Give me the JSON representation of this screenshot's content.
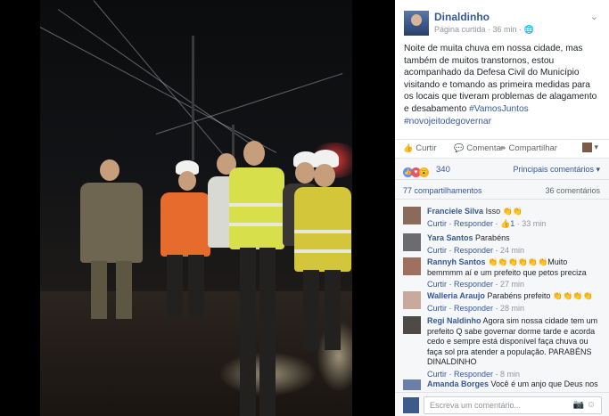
{
  "post": {
    "author": "Dinaldinho",
    "meta": "Página curtida · 36 min · 🌐",
    "text": "Noite de muita chuva em nossa cidade, mas também de muitos transtornos, estou acompanhado da Defesa Civil do Município visitando e tomando as primeira medidas para os locais que tiveram problemas de alagamento e desabamento",
    "hashtags": "#VamosJuntos #novojeitodegovernar",
    "caret": "⌄"
  },
  "actions": {
    "like": "Curtir",
    "comment": "Comentar",
    "share": "Compartilhar",
    "viewer_caret": "▾"
  },
  "reactions": {
    "count": "340",
    "top_comments": "Principais comentários ▾",
    "shares": "77 compartilhamentos",
    "comments": "36 comentários"
  },
  "comments": [
    {
      "name": "Franciele Silva",
      "text": "Isso 👏👏",
      "reply": "Curtir · Responder · ",
      "likes": "👍1",
      "time": " · 33 min"
    },
    {
      "name": "Yara Santos",
      "text": "Parabéns",
      "reply": "Curtir · Responder · ",
      "likes": "",
      "time": "24 min"
    },
    {
      "name": "Rannyh Santos",
      "text": "👏👏👏👏👏👏Muito bemmmm aí e um prefeito que petos preciza",
      "reply": "Curtir · Responder · ",
      "likes": "",
      "time": "27 min"
    },
    {
      "name": "Walleria Araujo",
      "text": "Parabéns prefeito 👏👏👏👏",
      "reply": "Curtir · Responder · ",
      "likes": "",
      "time": "28 min"
    },
    {
      "name": "Regi Naldinho",
      "text": "Agora sim nossa cidade tem um prefeito Q sabe governar dorme tarde e acorda cedo e sempre está disponível faça chuva ou faça sol pra atender a população. PARABÉNS DINALDINHO",
      "reply": "Curtir · Responder · ",
      "likes": "",
      "time": "8 min"
    },
    {
      "name": "Amanda Borges",
      "text": "Você é um anjo que Deus nos",
      "reply": "",
      "likes": "",
      "time": ""
    }
  ],
  "write": {
    "placeholder": "Escreva um comentário...",
    "icons": "📷 ☺"
  }
}
